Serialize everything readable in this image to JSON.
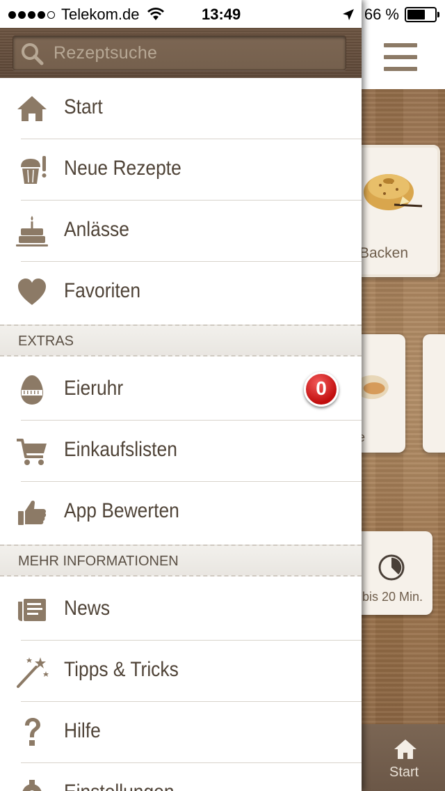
{
  "status_bar": {
    "carrier": "Telekom.de",
    "time": "13:49",
    "battery": "66 %",
    "signal_bars_filled": 4,
    "signal_bars_total": 5
  },
  "search": {
    "placeholder": "Rezeptsuche",
    "icon": "search-icon"
  },
  "menu": {
    "items": [
      {
        "label": "Start",
        "icon": "home-icon"
      },
      {
        "label": "Neue Rezepte",
        "icon": "new-recipe-icon"
      },
      {
        "label": "Anlässe",
        "icon": "birthday-cake-icon"
      },
      {
        "label": "Favoriten",
        "icon": "heart-icon"
      }
    ],
    "extras_header": "EXTRAS",
    "extras": [
      {
        "label": "Eieruhr",
        "icon": "egg-timer-icon",
        "badge": "0"
      },
      {
        "label": "Einkaufslisten",
        "icon": "cart-icon"
      },
      {
        "label": "App Bewerten",
        "icon": "thumbs-up-icon"
      }
    ],
    "more_header": "MEHR INFORMATIONEN",
    "more": [
      {
        "label": "News",
        "icon": "news-icon"
      },
      {
        "label": "Tipps & Tricks",
        "icon": "magic-wand-icon"
      },
      {
        "label": "Hilfe",
        "icon": "help-icon"
      },
      {
        "label": "Einstellungen",
        "icon": "settings-icon"
      }
    ]
  },
  "background_app": {
    "cards": [
      {
        "label": "Backen"
      },
      {
        "label": "e"
      },
      {
        "label": "bis 20 Min."
      }
    ],
    "bottom_tab": {
      "label": "Start",
      "icon": "home-icon"
    }
  },
  "colors": {
    "menu_text": "#4f4337",
    "icon_brown": "#8c7a66",
    "badge_red": "#c10d0d",
    "search_bar_bg": "#6b5340"
  }
}
